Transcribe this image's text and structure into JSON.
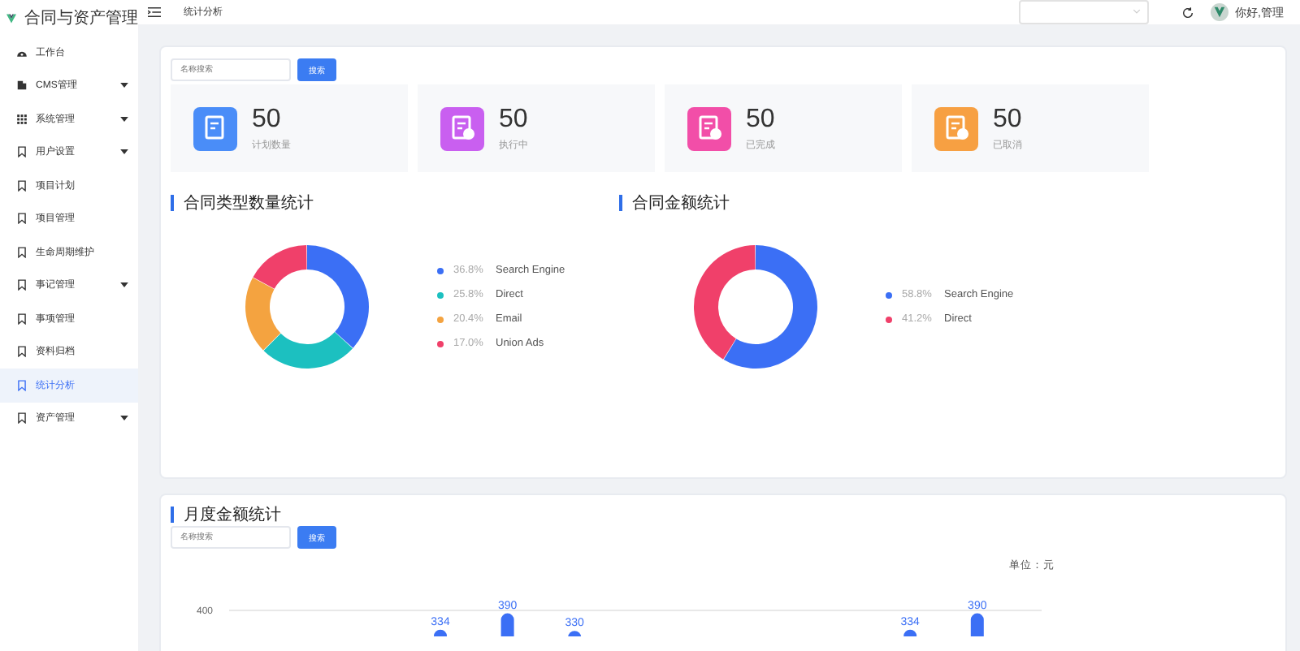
{
  "header": {
    "title": "合同与资产管理",
    "breadcrumb": "统计分析",
    "greeting": "你好,管理"
  },
  "sidebar": {
    "items": [
      {
        "label": "工作台",
        "expandable": false,
        "selected": false
      },
      {
        "label": "CMS管理",
        "expandable": true,
        "selected": false
      },
      {
        "label": "系统管理",
        "expandable": true,
        "selected": false
      },
      {
        "label": "用户设置",
        "expandable": true,
        "selected": false
      },
      {
        "label": "项目计划",
        "expandable": false,
        "selected": false
      },
      {
        "label": "项目管理",
        "expandable": false,
        "selected": false
      },
      {
        "label": "生命周期维护",
        "expandable": false,
        "selected": false
      },
      {
        "label": "事记管理",
        "expandable": true,
        "selected": false
      },
      {
        "label": "事项管理",
        "expandable": false,
        "selected": false
      },
      {
        "label": "资料归档",
        "expandable": false,
        "selected": false
      },
      {
        "label": "统计分析",
        "expandable": false,
        "selected": true
      },
      {
        "label": "资产管理",
        "expandable": true,
        "selected": false
      }
    ]
  },
  "filter": {
    "placeholder": "名称搜索",
    "button": "搜索"
  },
  "stats": [
    {
      "value": "50",
      "label": "计划数量",
      "color": "#4a8df8"
    },
    {
      "value": "50",
      "label": "执行中",
      "color": "#c95ff0"
    },
    {
      "value": "50",
      "label": "已完成",
      "color": "#f24ea8"
    },
    {
      "value": "50",
      "label": "已取消",
      "color": "#f7a042"
    }
  ],
  "type_panel": {
    "title": "合同类型数量统计",
    "chart_data": {
      "type": "donut",
      "values": [
        36.8,
        25.8,
        20.4,
        17.0
      ]
    },
    "legend": [
      {
        "color": "#3b6ff5",
        "percent": "36.8%",
        "label": "Search Engine"
      },
      {
        "color": "#1cc0c0",
        "percent": "25.8%",
        "label": "Direct"
      },
      {
        "color": "#f4a340",
        "percent": "20.4%",
        "label": "Email"
      },
      {
        "color": "#f0406a",
        "percent": "17.0%",
        "label": "Union Ads"
      }
    ]
  },
  "amount_panel": {
    "title": "合同金额统计",
    "chart_data": {
      "type": "donut",
      "values": [
        58.8,
        41.2
      ]
    },
    "legend": [
      {
        "color": "#3b6ff5",
        "percent": "58.8%",
        "label": "Search Engine"
      },
      {
        "color": "#f0406a",
        "percent": "41.2%",
        "label": "Direct"
      }
    ]
  },
  "monthly_panel": {
    "title": "月度金额统计",
    "filter": {
      "placeholder": "名称搜索",
      "button": "搜索"
    },
    "unit": "单位：元",
    "axis_label": "400",
    "bar_groups": [
      [
        "334",
        "390",
        "330"
      ],
      [
        "334",
        "390"
      ]
    ]
  }
}
